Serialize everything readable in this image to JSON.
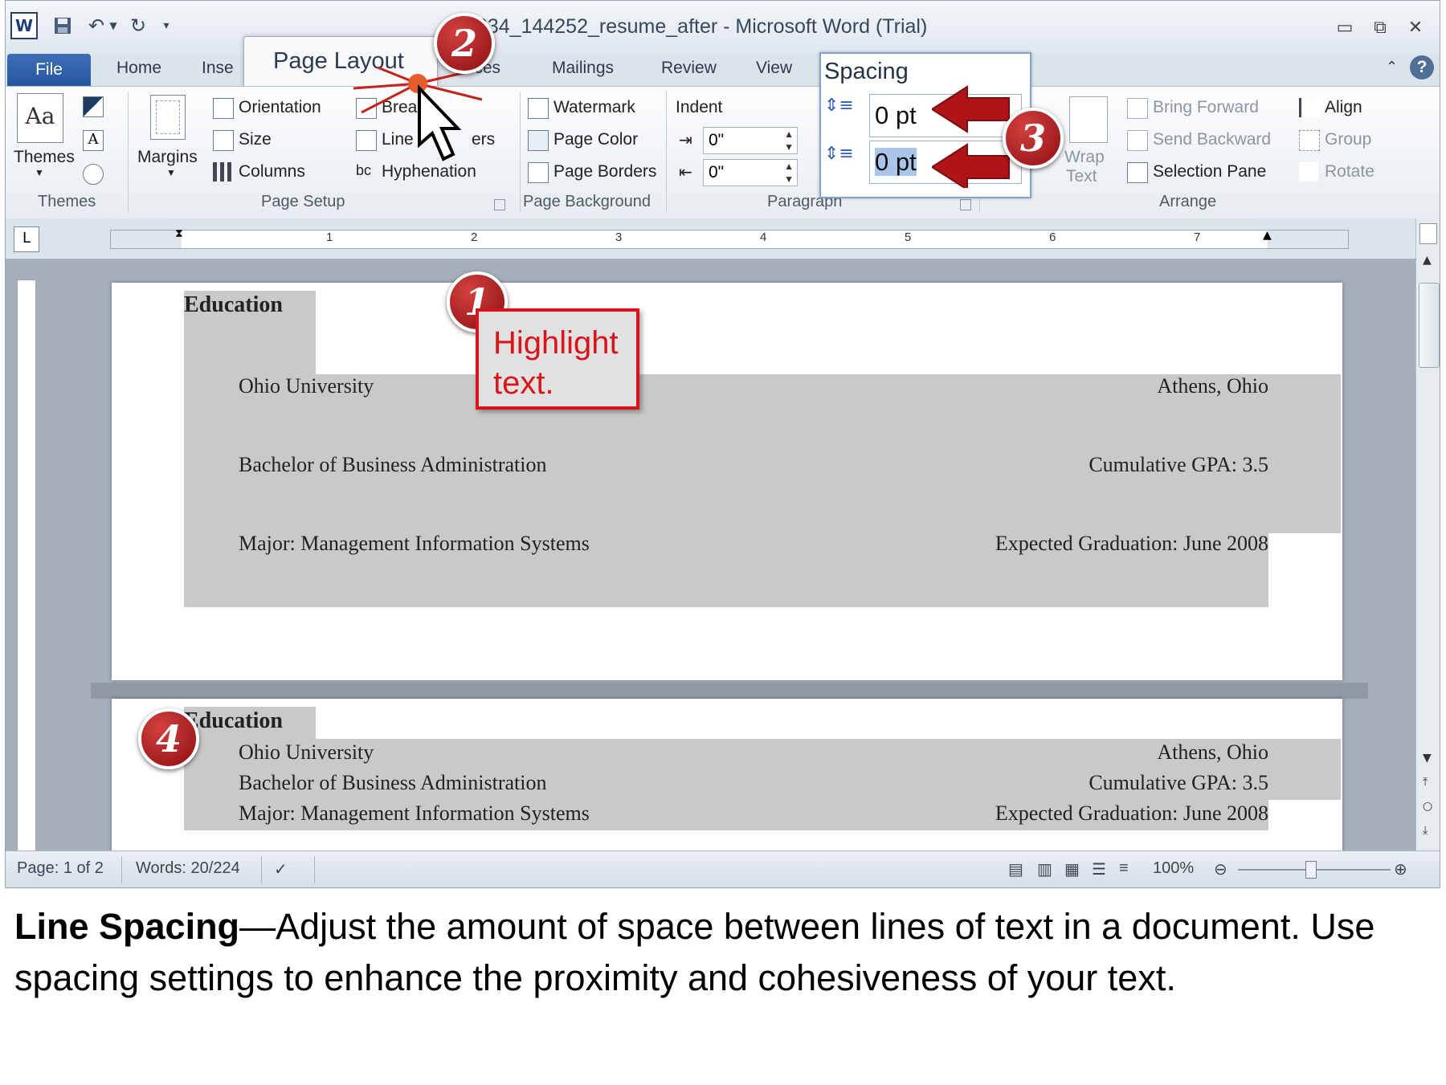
{
  "window": {
    "title": "11634_144252_resume_after  -  Microsoft Word (Trial)",
    "app_icon": "W"
  },
  "tabs": {
    "file": "File",
    "home": "Home",
    "insert": "Inse",
    "page_layout": "Page Layout",
    "references": "ences",
    "mailings": "Mailings",
    "review": "Review",
    "view": "View"
  },
  "ribbon": {
    "themes": {
      "button": "Themes",
      "group": "Themes"
    },
    "page_setup": {
      "orientation": "Orientation",
      "size": "Size",
      "columns": "Columns",
      "margins": "Margins",
      "breaks": "Brea",
      "line_numbers_a": "Line",
      "line_numbers_b": "ers",
      "hyphenation": "Hyphenation",
      "group": "Page Setup"
    },
    "page_background": {
      "watermark": "Watermark",
      "page_color": "Page Color",
      "page_borders": "Page Borders",
      "group": "Page Background"
    },
    "paragraph": {
      "indent_label": "Indent",
      "indent_left": "0\"",
      "indent_right": "0\"",
      "spacing_label": "Spacing",
      "spacing_before": "0 pt",
      "spacing_after": "0 pt",
      "group": "Paragraph"
    },
    "arrange": {
      "wrap_text_a": "Wrap",
      "wrap_text_b": "Text",
      "bring_forward": "Bring Forward",
      "send_backward": "Send Backward",
      "selection_pane": "Selection Pane",
      "align": "Align",
      "group_btn": "Group",
      "rotate": "Rotate",
      "group": "Arrange"
    }
  },
  "ruler": {
    "numbers": [
      "1",
      "2",
      "3",
      "4",
      "5",
      "6",
      "7"
    ]
  },
  "document": {
    "before": {
      "heading": "Education",
      "rows": [
        {
          "left": "Ohio University",
          "right": "Athens, Ohio"
        },
        {
          "left": "Bachelor of Business Administration",
          "right": "Cumulative GPA: 3.5"
        },
        {
          "left": "Major: Management Information Systems",
          "right": "Expected Graduation: June 2008"
        }
      ]
    },
    "after": {
      "heading": "Education",
      "rows": [
        {
          "left": "Ohio University",
          "right": "Athens, Ohio"
        },
        {
          "left": "Bachelor of Business Administration",
          "right": "Cumulative GPA: 3.5"
        },
        {
          "left": "Major: Management Information Systems",
          "right": "Expected Graduation: June 2008"
        }
      ]
    }
  },
  "status": {
    "page": "Page: 1 of 2",
    "words": "Words: 20/224",
    "zoom": "100%"
  },
  "annotations": {
    "step1": "1",
    "step2": "2",
    "step3": "3",
    "step4": "4",
    "callout": "Highlight text.",
    "accent_color": "#d9141b"
  },
  "caption": {
    "bold": "Line Spacing",
    "rest": "—Adjust the amount of space between lines of text in a document. Use spacing settings to enhance the proximity and cohesiveness of your text."
  }
}
